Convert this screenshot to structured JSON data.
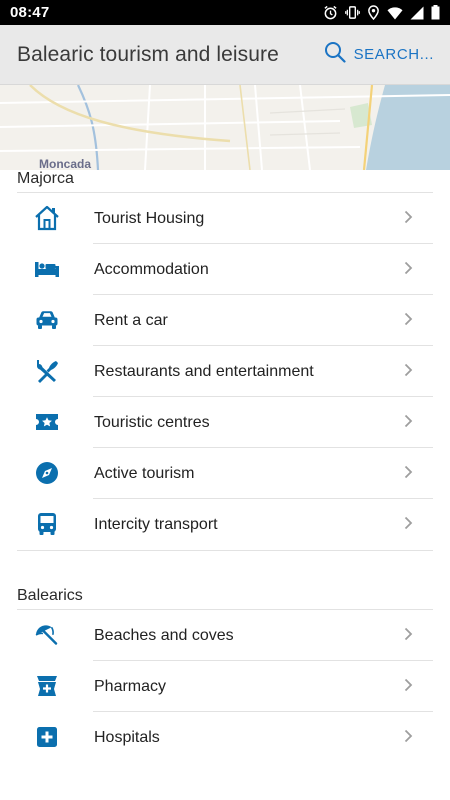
{
  "status_bar": {
    "time": "08:47",
    "icons": [
      "alarm-icon",
      "vibrate-icon",
      "location-icon",
      "wifi-icon",
      "signal-icon",
      "battery-icon"
    ]
  },
  "app_bar": {
    "title": "Balearic tourism and leisure",
    "search_label": "SEARCH...",
    "accent_color": "#1b74c4"
  },
  "map": {
    "place_label": "Moncada"
  },
  "sections": [
    {
      "title": "Majorca",
      "items": [
        {
          "label": "Tourist Housing",
          "icon": "house-icon"
        },
        {
          "label": "Accommodation",
          "icon": "bed-icon"
        },
        {
          "label": "Rent a car",
          "icon": "car-icon"
        },
        {
          "label": "Restaurants and entertainment",
          "icon": "cutlery-icon"
        },
        {
          "label": "Touristic centres",
          "icon": "ticket-star-icon"
        },
        {
          "label": "Active tourism",
          "icon": "compass-icon"
        },
        {
          "label": "Intercity transport",
          "icon": "bus-icon"
        }
      ]
    },
    {
      "title": "Balearics",
      "items": [
        {
          "label": "Beaches and coves",
          "icon": "beach-umbrella-icon"
        },
        {
          "label": "Pharmacy",
          "icon": "pharmacy-icon"
        },
        {
          "label": "Hospitals",
          "icon": "hospital-cross-icon"
        }
      ]
    }
  ],
  "colors": {
    "icon": "#0b6fae",
    "chevron": "#9e9e9e",
    "divider": "#e2e2e2"
  }
}
